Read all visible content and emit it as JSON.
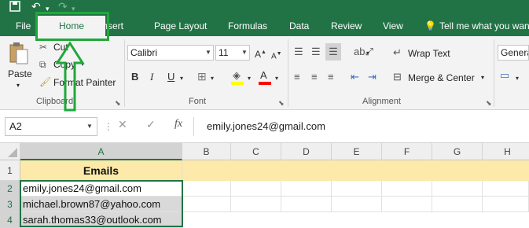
{
  "titlebar": {
    "save_icon": "save-icon",
    "undo_icon": "undo-icon",
    "redo_icon": "redo-icon"
  },
  "tabs": {
    "file": "File",
    "home": "Home",
    "insert": "Insert",
    "page_layout": "Page Layout",
    "formulas": "Formulas",
    "data": "Data",
    "review": "Review",
    "view": "View",
    "tell_me": "Tell me what you want to do"
  },
  "ribbon": {
    "clipboard": {
      "paste": "Paste",
      "cut": "Cut",
      "copy": "Copy",
      "format_painter": "Format Painter",
      "label": "Clipboard"
    },
    "font": {
      "font_name": "Calibri",
      "font_size": "11",
      "bold": "B",
      "italic": "I",
      "underline": "U",
      "font_color_letter": "A",
      "label": "Font"
    },
    "alignment": {
      "wrap_text": "Wrap Text",
      "merge_center": "Merge & Center",
      "label": "Alignment"
    },
    "number": {
      "format": "General"
    }
  },
  "formula_bar": {
    "name_box": "A2",
    "fx": "fx",
    "formula": "emily.jones24@gmail.com"
  },
  "grid": {
    "columns": [
      "A",
      "B",
      "C",
      "D",
      "E",
      "F",
      "G",
      "H"
    ],
    "rows": [
      {
        "num": "1",
        "a": "Emails"
      },
      {
        "num": "2",
        "a": "emily.jones24@gmail.com"
      },
      {
        "num": "3",
        "a": "michael.brown87@yahoo.com"
      },
      {
        "num": "4",
        "a": "sarah.thomas33@outlook.com"
      }
    ]
  },
  "colors": {
    "brand_green": "#217346",
    "header_row_fill": "#fde9a9",
    "annotation_green": "#1fa83a"
  }
}
